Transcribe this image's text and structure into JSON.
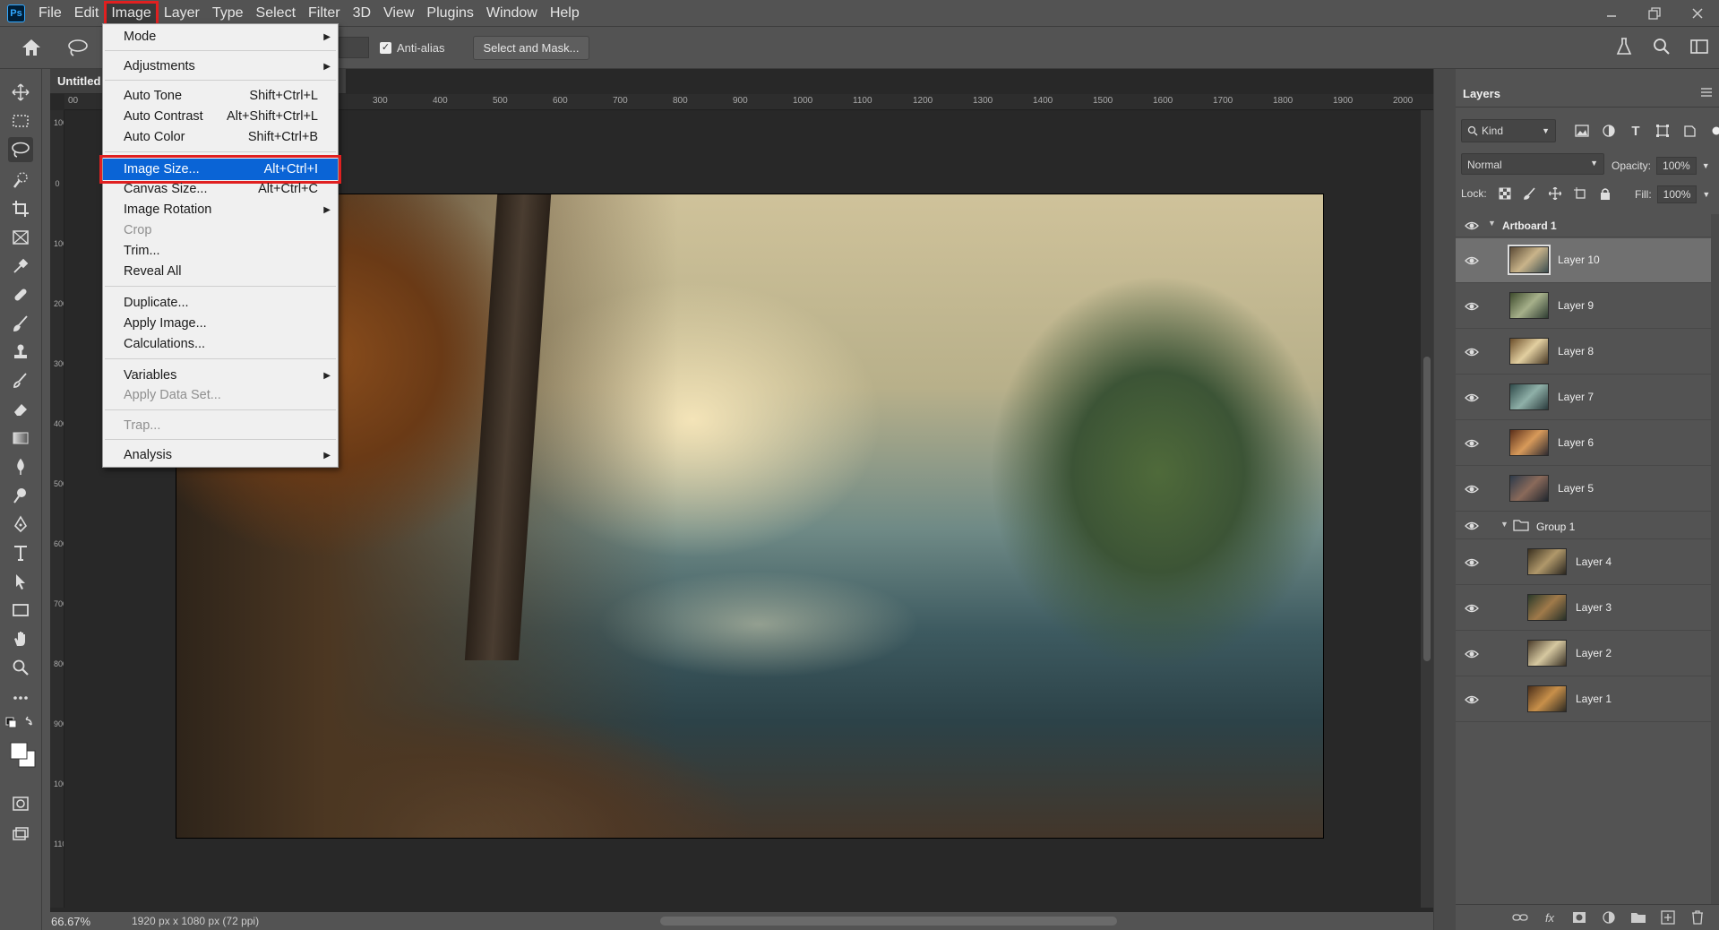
{
  "menubar": {
    "logo": "Ps",
    "items": [
      "File",
      "Edit",
      "Image",
      "Layer",
      "Type",
      "Select",
      "Filter",
      "3D",
      "View",
      "Plugins",
      "Window",
      "Help"
    ]
  },
  "options": {
    "antialias_label": "Anti-alias",
    "antialias_checked": true,
    "select_mask_label": "Select and Mask..."
  },
  "document": {
    "tab_label": "Untitled",
    "ruler_marks": [
      "00",
      "300",
      "400",
      "500",
      "600",
      "700",
      "800",
      "900",
      "1000",
      "1100",
      "1200",
      "1300",
      "1400",
      "1500",
      "1600",
      "1700",
      "1800",
      "1900",
      "2000"
    ],
    "left_ruler_marks": [
      "100",
      "0",
      "100",
      "200",
      "300",
      "400",
      "500",
      "600",
      "700",
      "800",
      "900",
      "1000",
      "1100"
    ]
  },
  "image_menu": {
    "mode": "Mode",
    "adjustments": "Adjustments",
    "auto_tone": "Auto Tone",
    "auto_tone_sc": "Shift+Ctrl+L",
    "auto_contrast": "Auto Contrast",
    "auto_contrast_sc": "Alt+Shift+Ctrl+L",
    "auto_color": "Auto Color",
    "auto_color_sc": "Shift+Ctrl+B",
    "image_size": "Image Size...",
    "image_size_sc": "Alt+Ctrl+I",
    "canvas_size": "Canvas Size...",
    "canvas_size_sc": "Alt+Ctrl+C",
    "image_rotation": "Image Rotation",
    "crop": "Crop",
    "trim": "Trim...",
    "reveal_all": "Reveal All",
    "duplicate": "Duplicate...",
    "apply_image": "Apply Image...",
    "calculations": "Calculations...",
    "variables": "Variables",
    "apply_data_set": "Apply Data Set...",
    "trap": "Trap...",
    "analysis": "Analysis"
  },
  "status": {
    "zoom": "66.67%",
    "info": "1920 px x 1080 px (72 ppi)"
  },
  "layers_panel": {
    "title": "Layers",
    "kind": "Kind",
    "blend_mode": "Normal",
    "opacity_label": "Opacity:",
    "opacity_value": "100%",
    "lock_label": "Lock:",
    "fill_label": "Fill:",
    "fill_value": "100%",
    "artboard": "Artboard 1",
    "group": "Group 1",
    "layers": [
      {
        "name": "Layer 10"
      },
      {
        "name": "Layer 9"
      },
      {
        "name": "Layer 8"
      },
      {
        "name": "Layer 7"
      },
      {
        "name": "Layer 6"
      },
      {
        "name": "Layer 5"
      },
      {
        "name": "Layer 4"
      },
      {
        "name": "Layer 3"
      },
      {
        "name": "Layer 2"
      },
      {
        "name": "Layer 1"
      }
    ]
  },
  "colors": {
    "highlight_box": "#e02020",
    "menu_selected": "#0a64d6",
    "panel_bg": "#535353"
  }
}
